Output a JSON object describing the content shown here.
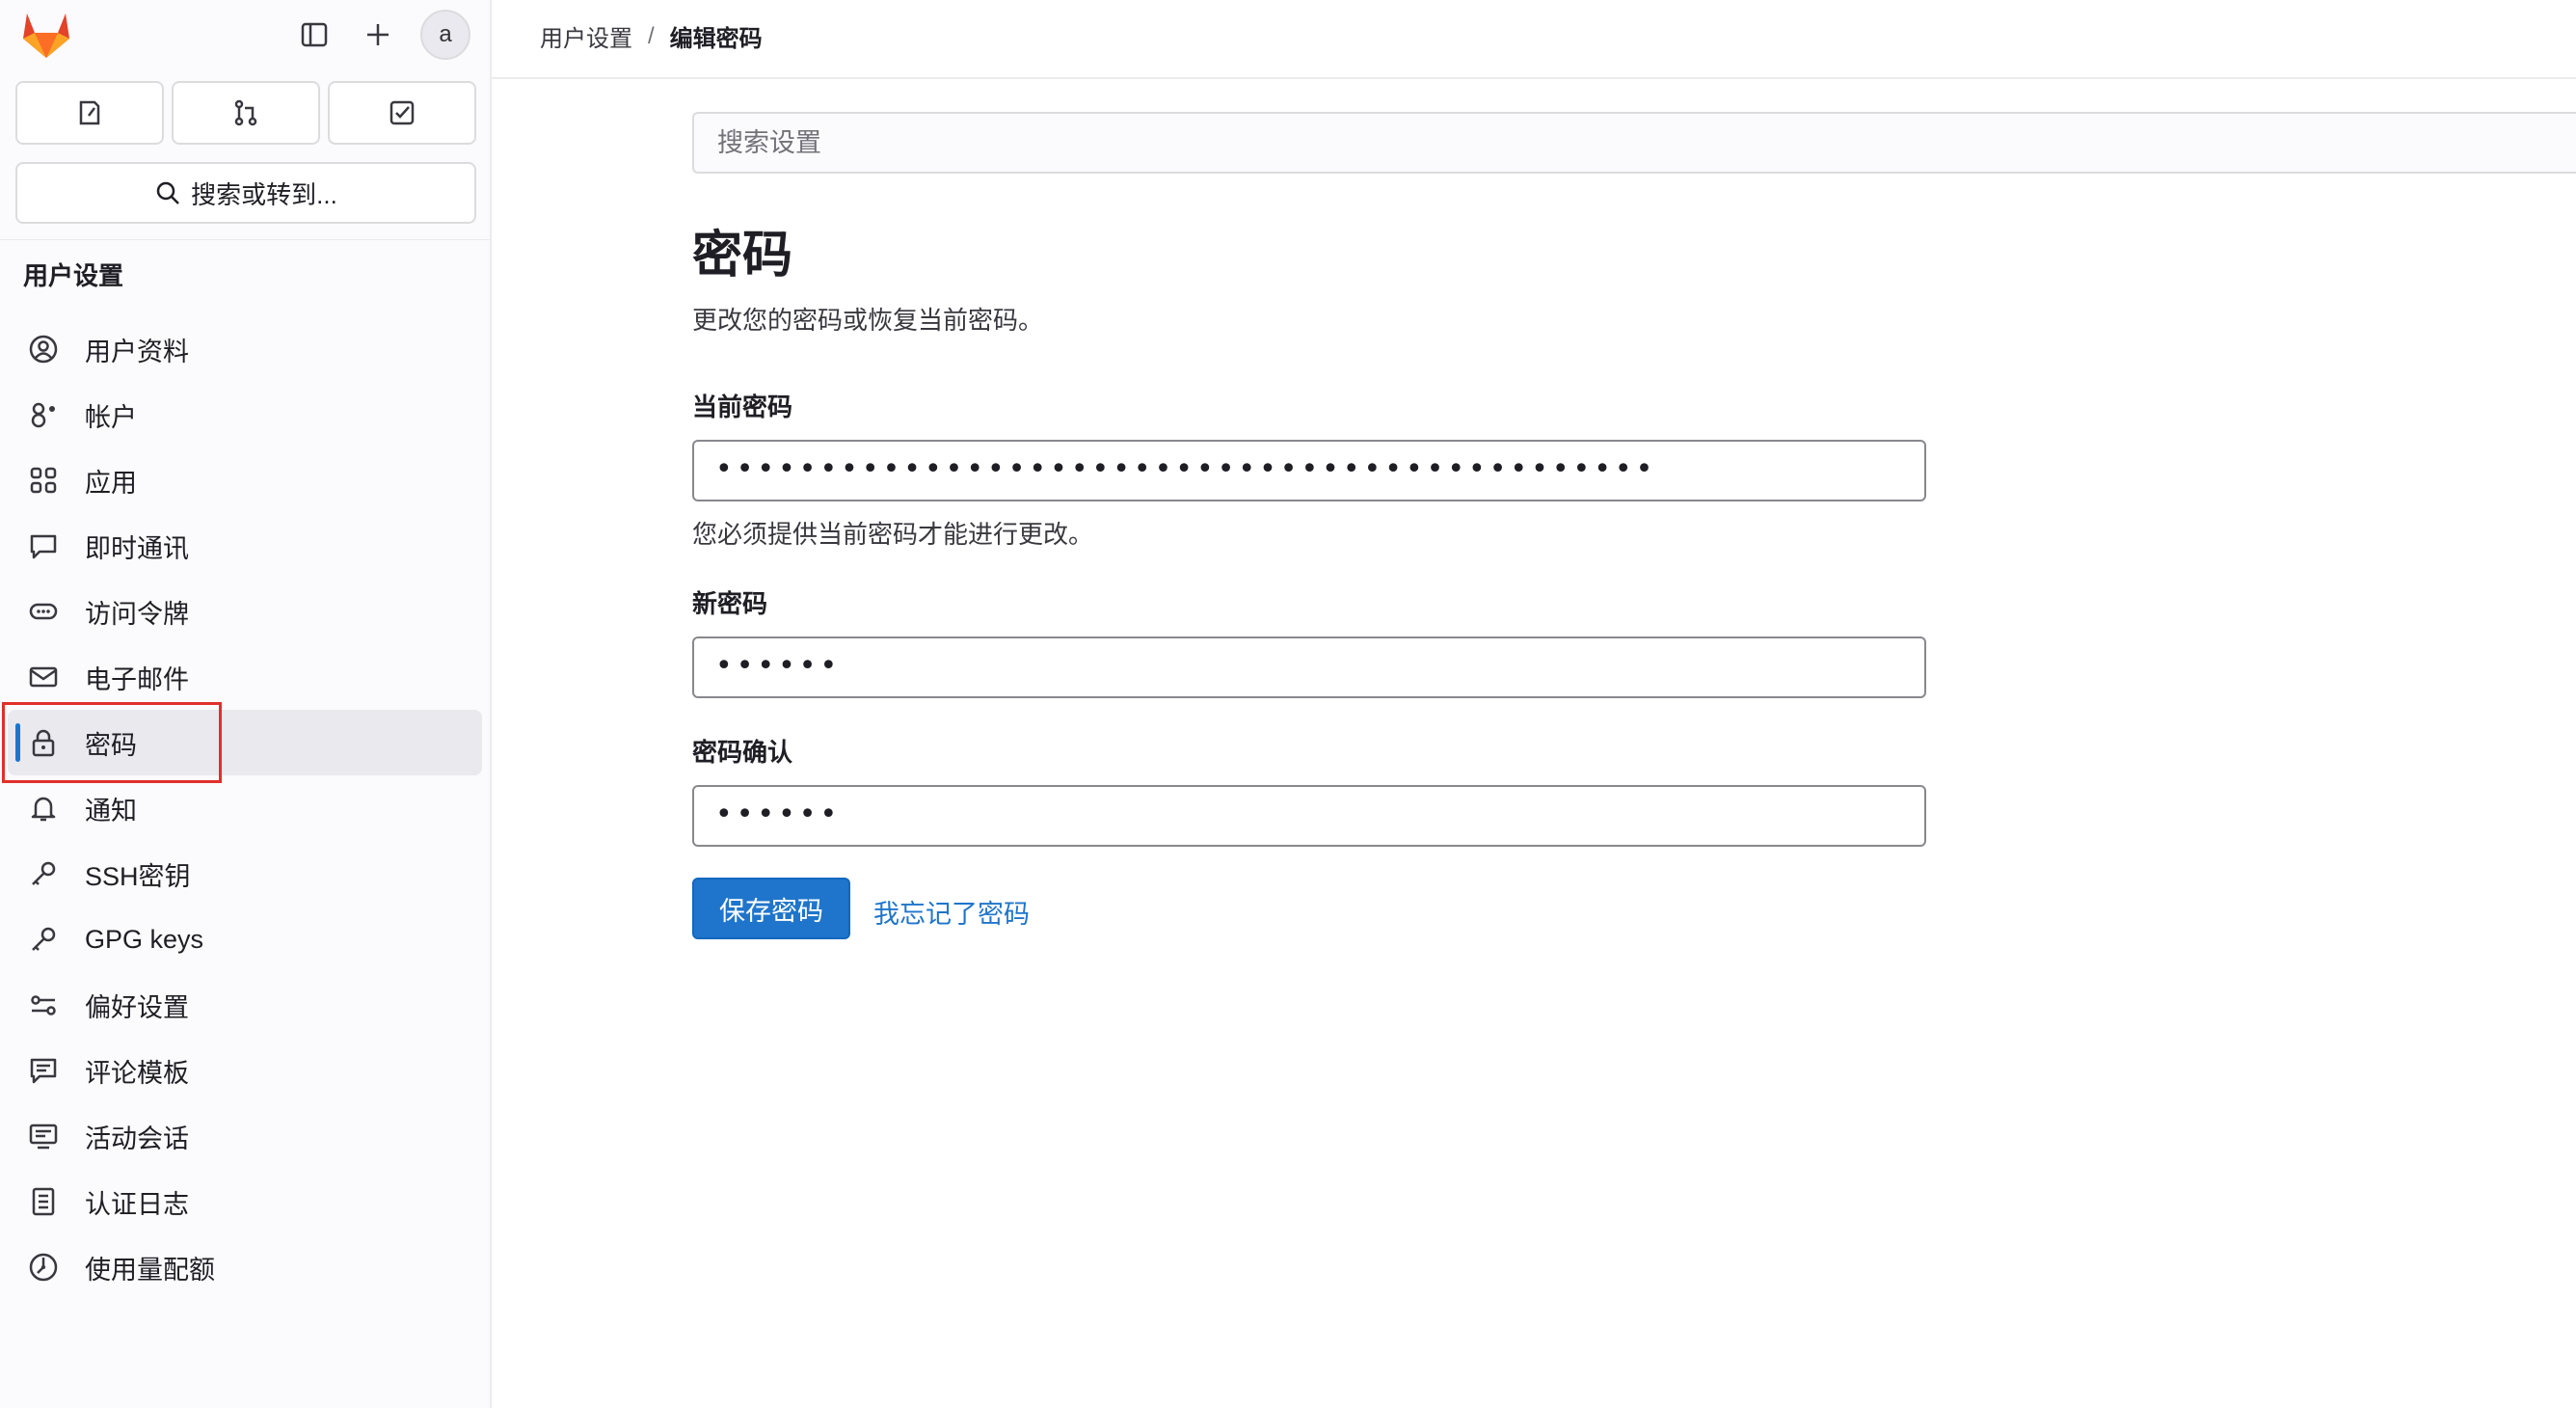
{
  "sidebar": {
    "avatar_text": "a",
    "search_label": "搜索或转到...",
    "section_title": "用户设置",
    "items": [
      {
        "label": "用户资料",
        "icon": "user-circle-icon"
      },
      {
        "label": "帐户",
        "icon": "account-icon"
      },
      {
        "label": "应用",
        "icon": "applications-icon"
      },
      {
        "label": "即时通讯",
        "icon": "chat-icon"
      },
      {
        "label": "访问令牌",
        "icon": "token-icon"
      },
      {
        "label": "电子邮件",
        "icon": "mail-icon"
      },
      {
        "label": "密码",
        "icon": "lock-icon",
        "active": true
      },
      {
        "label": "通知",
        "icon": "bell-icon"
      },
      {
        "label": "SSH密钥",
        "icon": "key-icon"
      },
      {
        "label": "GPG keys",
        "icon": "key-icon"
      },
      {
        "label": "偏好设置",
        "icon": "preferences-icon"
      },
      {
        "label": "评论模板",
        "icon": "comment-template-icon"
      },
      {
        "label": "活动会话",
        "icon": "monitor-icon"
      },
      {
        "label": "认证日志",
        "icon": "log-icon"
      },
      {
        "label": "使用量配额",
        "icon": "quota-icon"
      }
    ]
  },
  "breadcrumb": {
    "parent": "用户设置",
    "separator": "/",
    "current": "编辑密码"
  },
  "main": {
    "search_placeholder": "搜索设置",
    "title": "密码",
    "description": "更改您的密码或恢复当前密码。",
    "current_password": {
      "label": "当前密码",
      "value": "•••••••••••••••••••••••••••••••••••••••••••••",
      "help": "您必须提供当前密码才能进行更改。"
    },
    "new_password": {
      "label": "新密码",
      "value": "••••••"
    },
    "confirm_password": {
      "label": "密码确认",
      "value": "••••••"
    },
    "save_button": "保存密码",
    "forgot_link": "我忘记了密码"
  },
  "colors": {
    "accent": "#1f75cb",
    "highlight": "#e0302c",
    "sidebar_bg": "#fbfafd"
  }
}
